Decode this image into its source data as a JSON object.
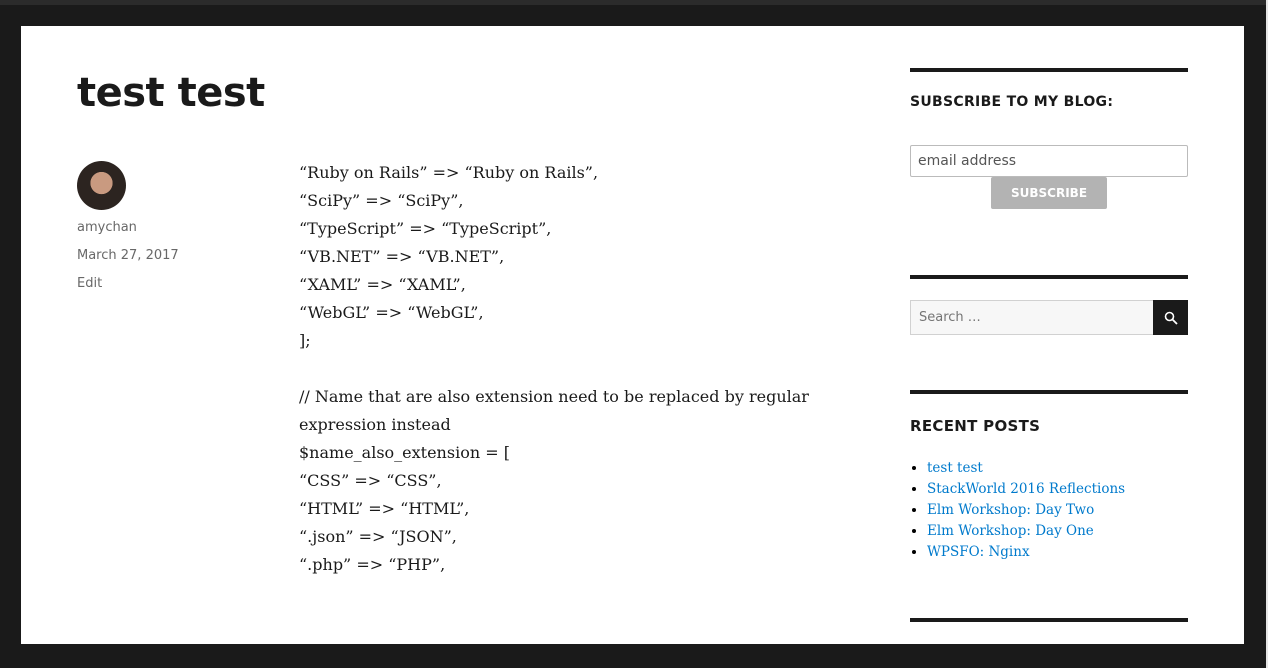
{
  "post": {
    "title": "test test",
    "author": "amychan",
    "date": "March 27, 2017",
    "edit": "Edit",
    "lines1": [
      "“Ruby on Rails” => “Ruby on Rails”,",
      "“SciPy” => “SciPy”,",
      "“TypeScript” => “TypeScript”,",
      "“VB.NET” => “VB.NET”,",
      "“XAML” => “XAML”,",
      "“WebGL” => “WebGL”,",
      "];"
    ],
    "lines2": [
      "// Name that are also extension need to be replaced by regular",
      "expression instead",
      "$name_also_extension = [",
      "“CSS” => “CSS”,",
      "“HTML” => “HTML”,",
      "“.json” => “JSON”,",
      "“.php” => “PHP”,"
    ]
  },
  "sidebar": {
    "subscribe_title": "SUBSCRIBE TO MY BLOG:",
    "email_value": "email address",
    "subscribe_button": "SUBSCRIBE",
    "search_placeholder": "Search …",
    "recent_title": "RECENT POSTS",
    "recent_posts": [
      "test test",
      "StackWorld 2016 Reflections",
      "Elm Workshop: Day Two",
      "Elm Workshop: Day One",
      "WPSFO: Nginx"
    ]
  }
}
